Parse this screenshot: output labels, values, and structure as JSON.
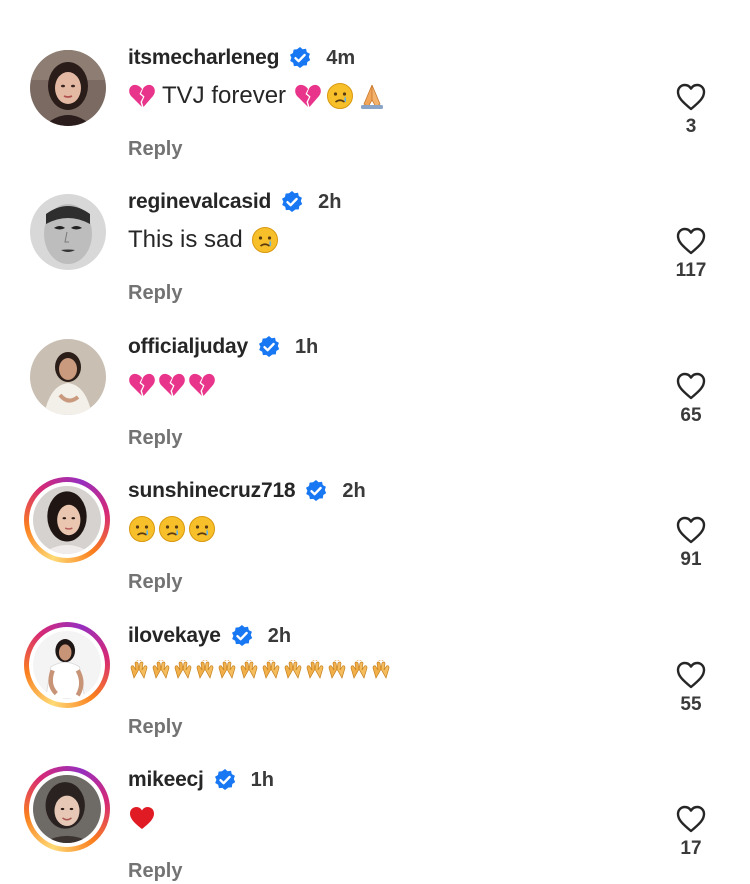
{
  "comments": [
    {
      "username": "itsmecharleneg",
      "time": "4m",
      "text": "TVJ forever",
      "reply": "Reply",
      "likes": "3",
      "emojis_before": [
        "broken-heart"
      ],
      "emojis_after": [
        "broken-heart",
        "crying-face",
        "folded-hands"
      ],
      "ring": false
    },
    {
      "username": "reginevalcasid",
      "time": "2h",
      "text": "This is sad",
      "reply": "Reply",
      "likes": "117",
      "emojis_before": [],
      "emojis_after": [
        "crying-face"
      ],
      "ring": false
    },
    {
      "username": "officialjuday",
      "time": "1h",
      "text": "",
      "reply": "Reply",
      "likes": "65",
      "emojis_before": [],
      "emojis_after": [
        "broken-heart",
        "broken-heart",
        "broken-heart"
      ],
      "ring": false
    },
    {
      "username": "sunshinecruz718",
      "time": "2h",
      "text": "",
      "reply": "Reply",
      "likes": "91",
      "emojis_before": [],
      "emojis_after": [
        "crying-face",
        "crying-face",
        "crying-face"
      ],
      "ring": true
    },
    {
      "username": "ilovekaye",
      "time": "2h",
      "text": "",
      "reply": "Reply",
      "likes": "55",
      "emojis_before": [],
      "emojis_after": [
        "clapping-hands-x12"
      ],
      "ring": true
    },
    {
      "username": "mikeecj",
      "time": "1h",
      "text": "",
      "reply": "Reply",
      "likes": "17",
      "emojis_before": [],
      "emojis_after": [
        "red-heart"
      ],
      "ring": true
    }
  ],
  "colors": {
    "verified": "#1877f2",
    "broken_heart": "#e8348a",
    "red_heart": "#e01b24",
    "reply_text": "#737373",
    "story_ring": [
      "#feda75",
      "#fa7e1e",
      "#d62976",
      "#962fbf"
    ]
  },
  "icons": {
    "verified": "verified-badge-icon",
    "like": "heart-outline-icon"
  }
}
